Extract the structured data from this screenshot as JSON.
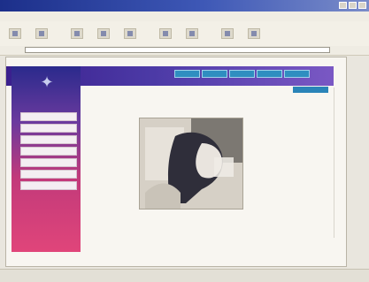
{
  "window": {
    "title": ""
  },
  "menu": {
    "items": [
      "",
      "",
      "",
      "",
      "",
      ""
    ]
  },
  "address": {
    "label": "",
    "url": ""
  },
  "site": {
    "sidebar_items": [
      "",
      "",
      "",
      "",
      "",
      "",
      ""
    ],
    "caption": ""
  },
  "status": {
    "left": "",
    "right": ""
  },
  "colors": {
    "title_bar": "#1c2f8a",
    "header_purple": "#4c3aa6",
    "sidebar_top": "#2a2a8c",
    "sidebar_bottom": "#e0457a",
    "nav_tab": "#2f8ec0"
  }
}
